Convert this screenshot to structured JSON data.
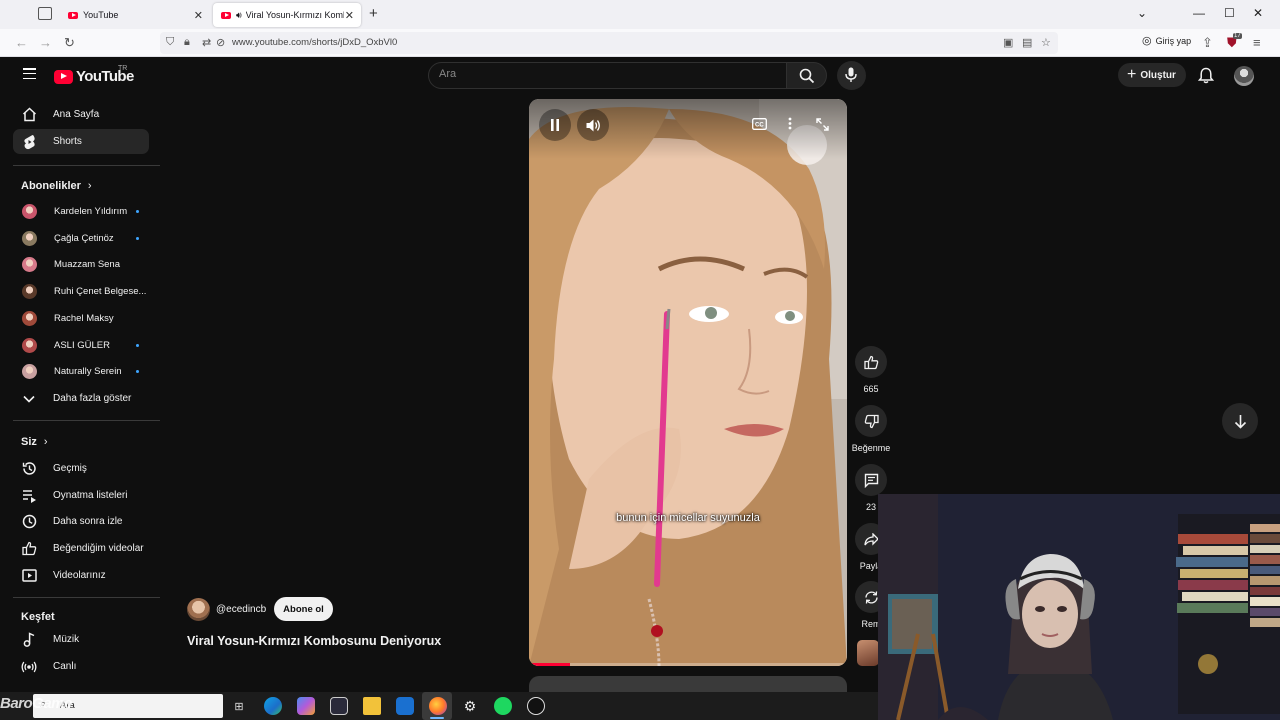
{
  "browser": {
    "tabs": [
      {
        "title": "YouTube",
        "active": false
      },
      {
        "title": "Viral Yosun-Kırmızı Kombos",
        "active": true
      }
    ],
    "url": "www.youtube.com/shorts/jDxD_OxbVl0",
    "login_label": "Giriş yap",
    "extension_badge": "17"
  },
  "header": {
    "logo_text": "YouTube",
    "country_code": "TR",
    "search_placeholder": "Ara",
    "create_label": "Oluştur"
  },
  "sidebar": {
    "main": [
      {
        "label": "Ana Sayfa",
        "icon": "home-icon"
      },
      {
        "label": "Shorts",
        "icon": "shorts-icon",
        "active": true
      }
    ],
    "subscriptions_title": "Abonelikler",
    "subscriptions": [
      {
        "name": "Kardelen Yıldırım",
        "new": true,
        "color": "#c9556b"
      },
      {
        "name": "Çağla Çetinöz",
        "new": true,
        "color": "#8a7a60"
      },
      {
        "name": "Muazzam Sena",
        "new": false,
        "color": "#d77a8a"
      },
      {
        "name": "Ruhi Çenet Belgese...",
        "new": false,
        "color": "#5a3a2a"
      },
      {
        "name": "Rachel Maksy",
        "new": false,
        "color": "#a04a3a"
      },
      {
        "name": "ASLI GÜLER",
        "new": true,
        "color": "#b04a4a"
      },
      {
        "name": "Naturally Serein",
        "new": true,
        "color": "#c8a0a0"
      }
    ],
    "show_more_label": "Daha fazla göster",
    "you_title": "Siz",
    "you_items": [
      {
        "label": "Geçmiş",
        "icon": "history-icon"
      },
      {
        "label": "Oynatma listeleri",
        "icon": "playlist-icon"
      },
      {
        "label": "Daha sonra izle",
        "icon": "clock-icon"
      },
      {
        "label": "Beğendiğim videolar",
        "icon": "thumbs-up-icon"
      },
      {
        "label": "Videolarınız",
        "icon": "video-icon"
      }
    ],
    "explore_title": "Keşfet",
    "explore_items": [
      {
        "label": "Müzik",
        "icon": "music-icon"
      },
      {
        "label": "Canlı",
        "icon": "live-icon"
      }
    ]
  },
  "short": {
    "subtitle": "bunun için micellar suyunuzla",
    "progress": 0.13,
    "channel": "@ecedincb",
    "subscribe_label": "Abone ol",
    "title": "Viral Yosun-Kırmızı Kombosunu Deniyorux"
  },
  "actions": {
    "likes": "665",
    "dislike_label": "Beğenme",
    "comments": "23",
    "share_label": "Payla",
    "remix_label": "Rem"
  },
  "taskbar": {
    "search_text": "Ara",
    "watermark": "BaroGame"
  }
}
